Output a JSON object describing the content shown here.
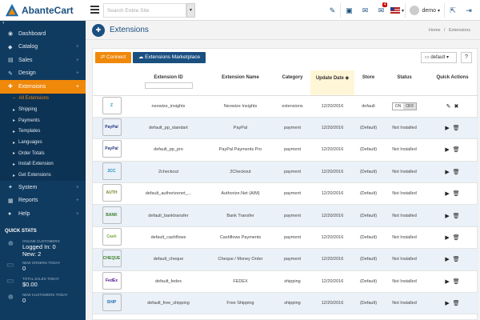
{
  "app": {
    "logo_text": "AbanteCart"
  },
  "search": {
    "placeholder": "Search Entire Site"
  },
  "topbar": {
    "user": "demo",
    "notif_count": "4"
  },
  "sidebar": {
    "items": [
      {
        "label": "Dashboard",
        "icon": "dashboard-icon",
        "plus": ""
      },
      {
        "label": "Catalog",
        "icon": "tag-icon",
        "plus": "+"
      },
      {
        "label": "Sales",
        "icon": "cart-icon",
        "plus": "+"
      },
      {
        "label": "Design",
        "icon": "brush-icon",
        "plus": "+"
      },
      {
        "label": "Extensions",
        "icon": "puzzle-icon",
        "plus": "+"
      }
    ],
    "sub_items": [
      {
        "label": "All Extensions"
      },
      {
        "label": "Shipping"
      },
      {
        "label": "Payments"
      },
      {
        "label": "Templates"
      },
      {
        "label": "Languages"
      },
      {
        "label": "Order Totals"
      },
      {
        "label": "Install Extension"
      },
      {
        "label": "Get Extensions"
      }
    ],
    "items2": [
      {
        "label": "System",
        "icon": "wrench-icon",
        "plus": "+"
      },
      {
        "label": "Reports",
        "icon": "chart-icon",
        "plus": "+"
      },
      {
        "label": "Help",
        "icon": "help-icon",
        "plus": "+"
      }
    ],
    "quick_stats": {
      "title": "QUICK STATS",
      "online_label": "ONLINE CUSTOMERS",
      "logged_in": "Logged In: 0",
      "new_count": "New: 2",
      "orders_label": "NEW ORDERS TODAY",
      "orders_value": "0",
      "sales_label": "TOTAL SALES TODAY",
      "sales_value": "$0.00",
      "customers_label": "NEW CUSTOMERS TODAY",
      "customers_value": "0"
    }
  },
  "page": {
    "title": "Extensions",
    "breadcrumb_home": "Home",
    "breadcrumb_sep": "/",
    "breadcrumb_current": "Extensions"
  },
  "toolbar": {
    "connect_label": "Connect",
    "market_label": "Extensions Marketplace",
    "default_label": "default",
    "help_label": "?"
  },
  "table": {
    "headers": {
      "id": "Extension ID",
      "name": "Extension Name",
      "category": "Category",
      "update": "Update Date",
      "store": "Store",
      "status": "Status",
      "actions": "Quick Actions"
    },
    "rows": [
      {
        "logo": "Z",
        "logo_color": "#1b9ad6",
        "id": "neowize_insights",
        "name": "Neowize Insights",
        "category": "extensions",
        "date": "12/20/2016",
        "store": "default",
        "status": "",
        "toggle_on": "ON",
        "toggle_off": "OFF",
        "installed": true
      },
      {
        "logo": "PayPal",
        "logo_color": "#253b80",
        "id": "default_pp_standart",
        "name": "PayPal",
        "category": "payment",
        "date": "12/20/2016",
        "store": "(Default)",
        "status": "Not Installed"
      },
      {
        "logo": "PayPal PRO",
        "logo_color": "#253b80",
        "id": "default_pp_pro",
        "name": "PayPal Payments Pro",
        "category": "payment",
        "date": "12/20/2016",
        "store": "(Default)",
        "status": "Not Installed"
      },
      {
        "logo": "2CC",
        "logo_color": "#1c8bc8",
        "id": "2checkout",
        "name": "2Checkout",
        "category": "payment",
        "date": "12/20/2016",
        "store": "(Default)",
        "status": "Not Installed"
      },
      {
        "logo": "AUTH",
        "logo_color": "#6b8e23",
        "id": "default_authorizenet_...",
        "name": "Authorize.Net (AIM)",
        "category": "payment",
        "date": "12/20/2016",
        "store": "(Default)",
        "status": "Not Installed"
      },
      {
        "logo": "BANK",
        "logo_color": "#3a7d2a",
        "id": "default_banktransfer",
        "name": "Bank Transfer",
        "category": "payment",
        "date": "12/20/2016",
        "store": "(Default)",
        "status": "Not Installed"
      },
      {
        "logo": "Cash",
        "logo_color": "#79a83a",
        "id": "default_cashflows",
        "name": "Cashflows Payments",
        "category": "payment",
        "date": "12/20/2016",
        "store": "(Default)",
        "status": "Not Installed"
      },
      {
        "logo": "CHEQUE",
        "logo_color": "#3a7d2a",
        "id": "default_cheque",
        "name": "Cheque / Money Order",
        "category": "payment",
        "date": "12/20/2016",
        "store": "(Default)",
        "status": "Not Installed"
      },
      {
        "logo": "FedEx",
        "logo_color": "#4d148c",
        "id": "default_fedex",
        "name": "FEDEX",
        "category": "shipping",
        "date": "12/20/2016",
        "store": "(Default)",
        "status": "Not Installed"
      },
      {
        "logo": "SHIP",
        "logo_color": "#2a6ab0",
        "id": "default_free_shipping",
        "name": "Free Shipping",
        "category": "shipping",
        "date": "12/20/2016",
        "store": "(Default)",
        "status": "Not Installed"
      }
    ]
  }
}
